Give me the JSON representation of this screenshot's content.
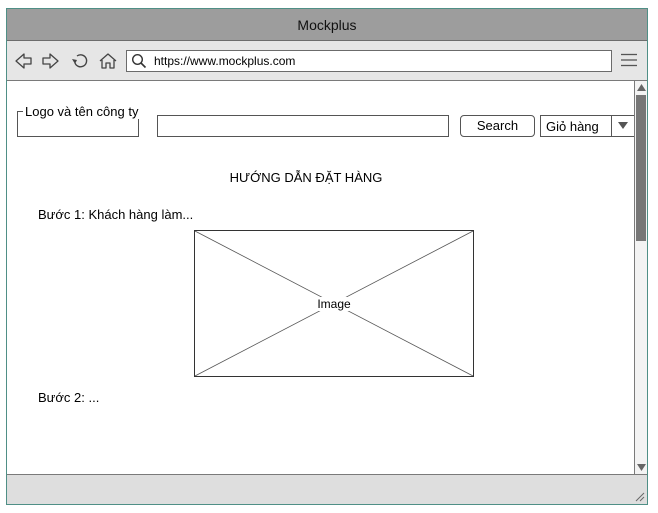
{
  "window": {
    "title": "Mockplus"
  },
  "browser": {
    "url": "https://www.mockplus.com",
    "icons": [
      "back-icon",
      "forward-icon",
      "refresh-icon",
      "home-icon",
      "search-icon",
      "menu-icon"
    ]
  },
  "header": {
    "logo_label": "Logo và tên công ty",
    "search_value": "",
    "search_button": "Search",
    "cart_select": "Giỏ hàng"
  },
  "main": {
    "title": "HƯỚNG DẪN ĐẶT HÀNG",
    "step1": "Bước 1: Khách hàng làm...",
    "image_label": "Image",
    "step2": "Bước 2: ..."
  },
  "colors": {
    "window_border": "#4f8f86",
    "titlebar": "#9d9d9d",
    "toolbar": "#e6e6e6",
    "scroll_thumb": "#777777"
  }
}
